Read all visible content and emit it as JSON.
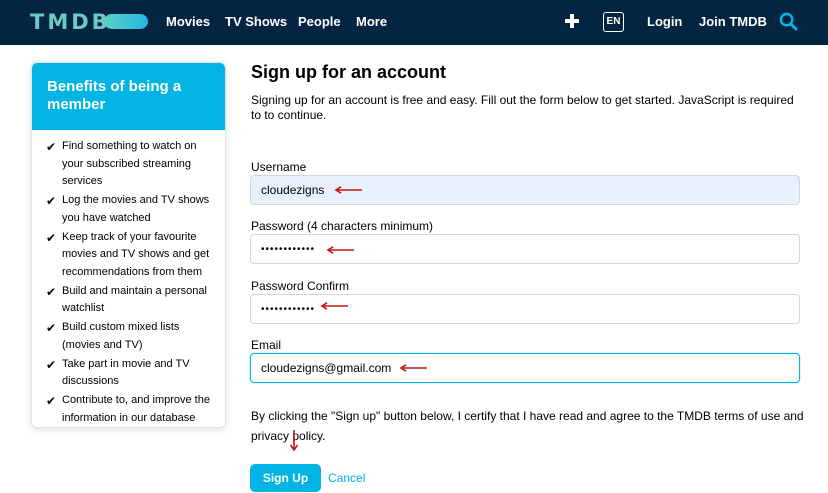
{
  "navbar": {
    "logo_text": "TMDB",
    "links": [
      "Movies",
      "TV Shows",
      "People",
      "More"
    ],
    "language": "EN",
    "login": "Login",
    "join": "Join TMDB"
  },
  "sidebar": {
    "title": "Benefits of being a member",
    "benefits": [
      "Find something to watch on your subscribed streaming services",
      "Log the movies and TV shows you have watched",
      "Keep track of your favourite movies and TV shows and get recommendations from them",
      "Build and maintain a personal watchlist",
      "Build custom mixed lists (movies and TV)",
      "Take part in movie and TV discussions",
      "Contribute to, and improve the information in our database"
    ]
  },
  "form": {
    "title": "Sign up for an account",
    "intro": "Signing up for an account is free and easy. Fill out the form below to get started. JavaScript is required to to continue.",
    "username_label": "Username",
    "username_value": "cloudezigns",
    "password_label": "Password (4 characters minimum)",
    "password_value": "••••••••••••",
    "confirm_label": "Password Confirm",
    "confirm_value": "••••••••••••",
    "email_label": "Email",
    "email_value": "cloudezigns@gmail.com",
    "terms": "By clicking the \"Sign up\" button below, I certify that I have read and agree to the TMDB terms of use and privacy policy.",
    "signup_button": "Sign Up",
    "cancel_link": "Cancel"
  },
  "colors": {
    "navbar_bg": "#032541",
    "accent": "#01b4e4",
    "logo_teal": "#6cc9c4",
    "annotation_red": "#c81414"
  }
}
